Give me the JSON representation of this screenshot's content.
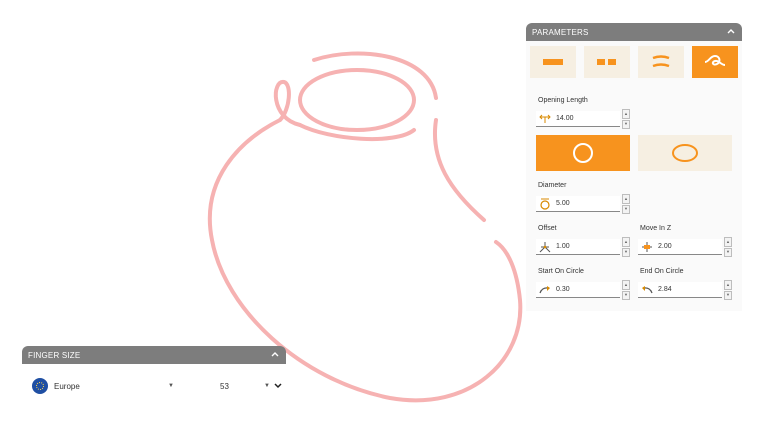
{
  "parameters": {
    "header": "PARAMETERS",
    "modes": [
      {
        "icon": "single-bar-icon",
        "active": false
      },
      {
        "icon": "double-bar-icon",
        "active": false
      },
      {
        "icon": "curved-bars-icon",
        "active": false
      },
      {
        "icon": "loop-icon",
        "active": true
      }
    ],
    "opening_length": {
      "label": "Opening Length",
      "value": "14.00",
      "icon": "opening-length-icon"
    },
    "shapes": [
      {
        "icon": "circle-shape-icon",
        "active": true
      },
      {
        "icon": "ellipse-shape-icon",
        "active": false
      }
    ],
    "diameter": {
      "label": "Diameter",
      "value": "5.00",
      "icon": "diameter-icon"
    },
    "offset": {
      "label": "Offset",
      "value": "1.00",
      "icon": "offset-icon"
    },
    "move_in_z": {
      "label": "Move In Z",
      "value": "2.00",
      "icon": "move-z-icon"
    },
    "start_on_circle": {
      "label": "Start On Circle",
      "value": "0.30",
      "icon": "start-circle-icon"
    },
    "end_on_circle": {
      "label": "End On Circle",
      "value": "2.84",
      "icon": "end-circle-icon"
    }
  },
  "finger_size": {
    "header": "FINGER SIZE",
    "region": "Europe",
    "size": "53"
  },
  "colors": {
    "accent": "#f7931e",
    "panel_header": "#7d7d7d",
    "curve": "#f6b2b2",
    "region_badge": "#1f4fa3"
  }
}
